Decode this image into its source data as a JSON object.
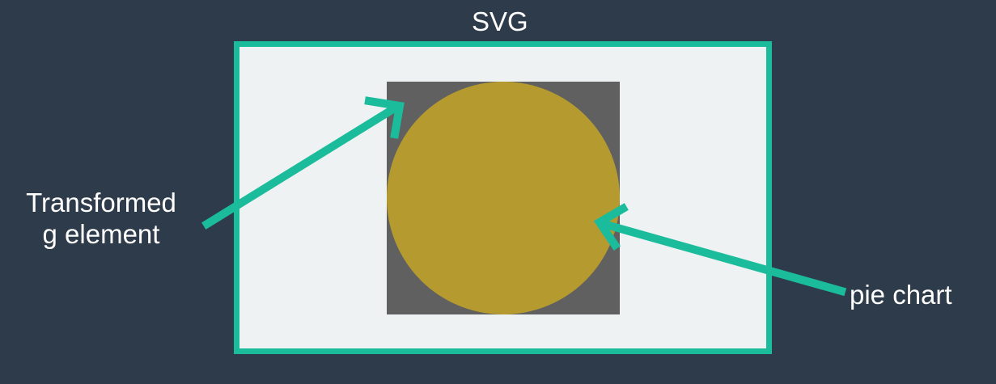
{
  "labels": {
    "title": "SVG",
    "left_line1": "Transformed",
    "left_line2": "g element",
    "right": "pie chart"
  },
  "colors": {
    "background": "#2e3b4a",
    "svg_border": "#1abc9c",
    "svg_fill": "#eef2f2",
    "group_fill": "#606060",
    "circle_fill": "#b59a2f",
    "arrow": "#1abc9c",
    "text": "#ffffff"
  }
}
